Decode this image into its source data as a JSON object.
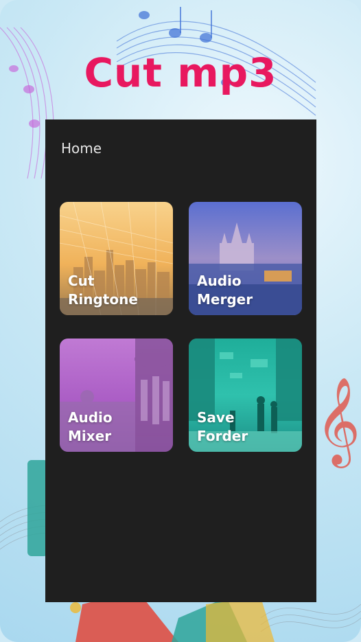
{
  "banner": {
    "title": "Cut mp3"
  },
  "screen": {
    "title": "Home"
  },
  "cards": [
    {
      "label": "Cut\nRingtone"
    },
    {
      "label": "Audio\nMerger"
    },
    {
      "label": "Audio\nMixer"
    },
    {
      "label": "Save\nForder"
    }
  ],
  "colors": {
    "title": "#e8185f",
    "panel": "#1f1f1f",
    "card1": "#f0b25a",
    "card2": "#6c7fd8",
    "card3": "#a95bc4",
    "card4": "#27b9a4"
  }
}
